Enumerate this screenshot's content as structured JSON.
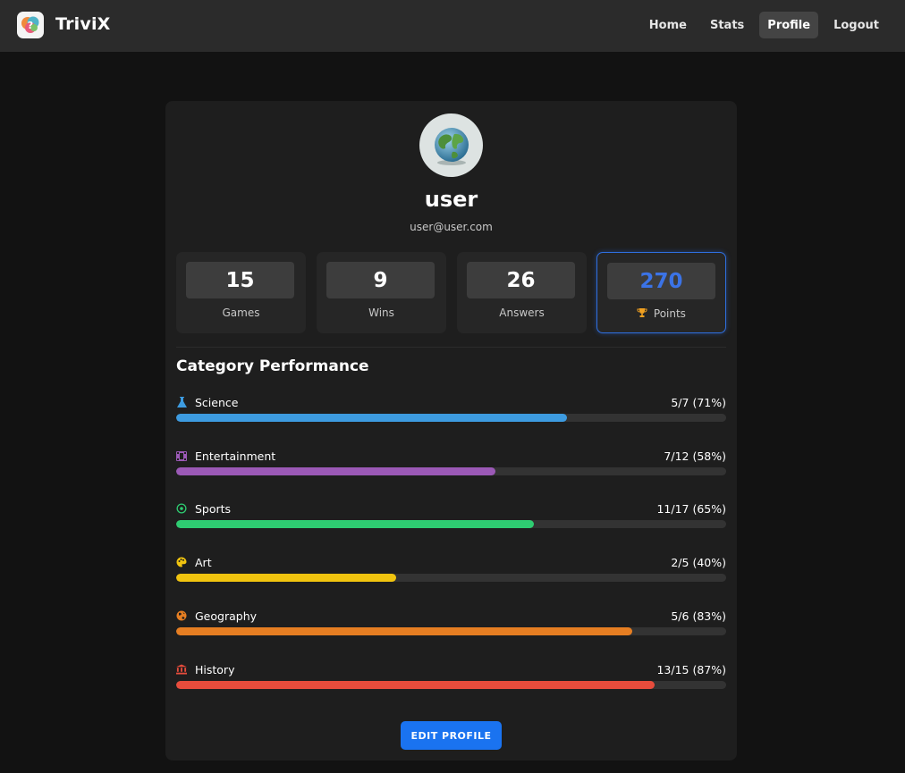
{
  "nav": {
    "brand": "TriviX",
    "links": [
      {
        "label": "Home",
        "active": false
      },
      {
        "label": "Stats",
        "active": false
      },
      {
        "label": "Profile",
        "active": true
      },
      {
        "label": "Logout",
        "active": false
      }
    ]
  },
  "profile": {
    "username": "user",
    "email": "user@user.com"
  },
  "stats": [
    {
      "value": "15",
      "label": "Games"
    },
    {
      "value": "9",
      "label": "Wins"
    },
    {
      "value": "26",
      "label": "Answers"
    },
    {
      "value": "270",
      "label": "Points",
      "icon": "trophy-icon",
      "highlight_color": "#2f6fe0"
    }
  ],
  "category_section": {
    "title": "Category Performance",
    "categories": [
      {
        "name": "Science",
        "score": "5/7 (71%)",
        "progress": 0.71,
        "color": "#3d9be0",
        "icon": "flask-icon"
      },
      {
        "name": "Entertainment",
        "score": "7/12 (58%)",
        "progress": 0.58,
        "color": "#9b59b6",
        "icon": "film-icon"
      },
      {
        "name": "Sports",
        "score": "11/17 (65%)",
        "progress": 0.65,
        "color": "#2ecc71",
        "icon": "soccer-ball-icon"
      },
      {
        "name": "Art",
        "score": "2/5 (40%)",
        "progress": 0.4,
        "color": "#f1c40f",
        "icon": "palette-icon"
      },
      {
        "name": "Geography",
        "score": "5/6 (83%)",
        "progress": 0.83,
        "color": "#e67e22",
        "icon": "globe-icon"
      },
      {
        "name": "History",
        "score": "13/15 (87%)",
        "progress": 0.87,
        "color": "#e74c3c",
        "icon": "landmark-icon"
      }
    ]
  },
  "actions": {
    "edit_label": "EDIT PROFILE",
    "edit_color": "#1a73f0"
  }
}
